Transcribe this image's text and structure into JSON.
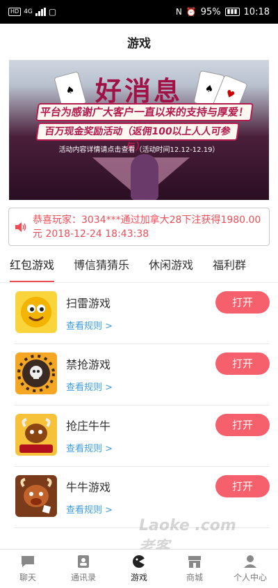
{
  "status": {
    "network": "4G",
    "battery_percent": "95%",
    "time": "10:18"
  },
  "page_title": "游戏",
  "banner": {
    "headline": "好消息",
    "line1": "平台为感谢广大客户一直以来的支持与厚爱！特推",
    "line2": "百万现金奖励活动（返佣100以上人人可参与）",
    "line3": "活动内容详情请点击查看（活动时间12.12-12.19）"
  },
  "notice": {
    "text": "恭喜玩家：3034***通过加拿大28下注获得1980.00元 2018-12-24 18:43:38"
  },
  "tabs": [
    "红包游戏",
    "博信猜猜乐",
    "休闲游戏",
    "福利群"
  ],
  "games": [
    {
      "name": "扫雷游戏",
      "rule": "查看规则 >",
      "button": "打开",
      "icon": "smiley-face-icon"
    },
    {
      "name": "禁抢游戏",
      "rule": "查看规则 >",
      "button": "打开",
      "icon": "skull-mine-icon"
    },
    {
      "name": "抢庄牛牛",
      "rule": "查看规则 >",
      "button": "打开",
      "icon": "bull-banker-icon"
    },
    {
      "name": "牛牛游戏",
      "rule": "查看规则 >",
      "button": "打开",
      "icon": "bull-game-icon"
    }
  ],
  "watermark": "Laoke .com老客",
  "bottom_nav": [
    {
      "label": "聊天",
      "icon": "chat-icon"
    },
    {
      "label": "通讯录",
      "icon": "contacts-icon"
    },
    {
      "label": "游戏",
      "icon": "game-icon"
    },
    {
      "label": "商城",
      "icon": "shop-icon"
    },
    {
      "label": "个人中心",
      "icon": "profile-icon"
    }
  ],
  "colors": {
    "accent": "#f65f6c",
    "notice_text": "#ee4d58",
    "link": "#3b9be0"
  }
}
